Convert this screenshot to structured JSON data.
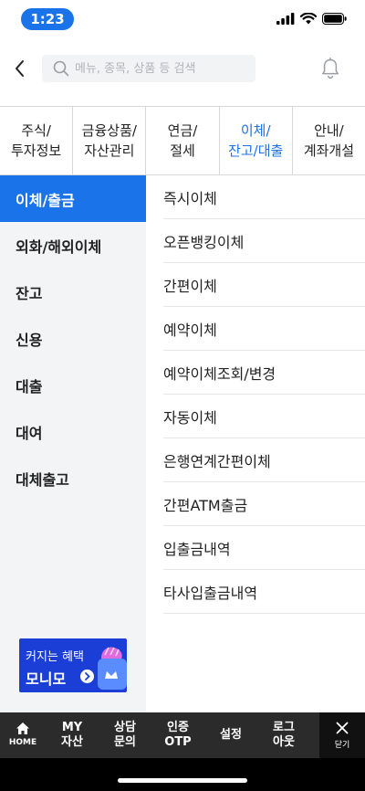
{
  "status": {
    "time": "1:23"
  },
  "search": {
    "placeholder": "메뉴, 종목, 상품 등 검색"
  },
  "categories": [
    {
      "label": "주식/\n투자정보"
    },
    {
      "label": "금융상품/\n자산관리"
    },
    {
      "label": "연금/\n절세"
    },
    {
      "label": "이체/\n잔고/대출",
      "active": true
    },
    {
      "label": "안내/\n계좌개설"
    }
  ],
  "left_nav": [
    {
      "label": "이체/출금",
      "active": true
    },
    {
      "label": "외화/해외이체"
    },
    {
      "label": "잔고"
    },
    {
      "label": "신용"
    },
    {
      "label": "대출"
    },
    {
      "label": "대여"
    },
    {
      "label": "대체출고"
    }
  ],
  "submenu": [
    "즉시이체",
    "오픈뱅킹이체",
    "간편이체",
    "예약이체",
    "예약이체조회/변경",
    "자동이체",
    "은행연계간편이체",
    "간편ATM출금",
    "입출금내역",
    "타사입출금내역"
  ],
  "promo": {
    "line1": "커지는 혜택",
    "line2": "모니모"
  },
  "bottom_bar": {
    "home": "HOME",
    "my_assets": "MY\n자산",
    "consult": "상담\n문의",
    "otp": "인증\nOTP",
    "settings": "설정",
    "logout": "로그\n아웃",
    "close": "닫기"
  },
  "colors": {
    "accent": "#1a73e8",
    "nav_bg": "#f3f4f6",
    "bottom_bar": "#2b2b2b",
    "promo_bg": "#1b3fd6"
  }
}
